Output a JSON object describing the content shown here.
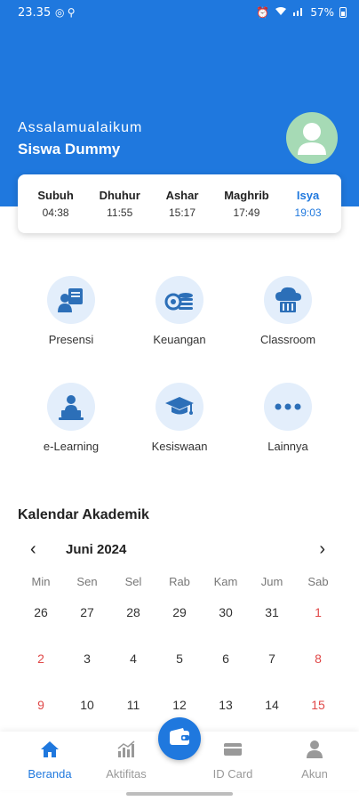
{
  "status": {
    "time": "23.35",
    "battery": "57%"
  },
  "header": {
    "greeting": "Assalamualaikum",
    "user_name": "Siswa Dummy",
    "bg_color": "#1f78de"
  },
  "prayers": [
    {
      "name": "Subuh",
      "time": "04:38"
    },
    {
      "name": "Dhuhur",
      "time": "11:55"
    },
    {
      "name": "Ashar",
      "time": "15:17"
    },
    {
      "name": "Maghrib",
      "time": "17:49"
    },
    {
      "name": "Isya",
      "time": "19:03",
      "active": true
    }
  ],
  "menu": [
    {
      "label": "Presensi",
      "icon": "attendance-icon"
    },
    {
      "label": "Keuangan",
      "icon": "coins-icon"
    },
    {
      "label": "Classroom",
      "icon": "cloud-classroom-icon"
    },
    {
      "label": "e-Learning",
      "icon": "laptop-teacher-icon"
    },
    {
      "label": "Kesiswaan",
      "icon": "graduation-cap-icon"
    },
    {
      "label": "Lainnya",
      "icon": "more-dots-icon"
    }
  ],
  "calendar": {
    "title": "Kalendar Akademik",
    "month": "Juni 2024",
    "weekdays": [
      "Min",
      "Sen",
      "Sel",
      "Rab",
      "Kam",
      "Jum",
      "Sab"
    ],
    "weeks": [
      [
        "26",
        "27",
        "28",
        "29",
        "30",
        "31",
        "1"
      ],
      [
        "2",
        "3",
        "4",
        "5",
        "6",
        "7",
        "8"
      ],
      [
        "9",
        "10",
        "11",
        "12",
        "13",
        "14",
        "15"
      ]
    ],
    "highlight_color": "#e04848"
  },
  "bottom_nav": [
    {
      "label": "Beranda",
      "icon": "home-icon",
      "active": true
    },
    {
      "label": "Aktifitas",
      "icon": "bar-chart-icon"
    },
    {
      "label": "ID Card",
      "icon": "id-card-icon"
    },
    {
      "label": "Akun",
      "icon": "account-icon"
    }
  ],
  "fab": {
    "icon": "wallet-icon"
  }
}
